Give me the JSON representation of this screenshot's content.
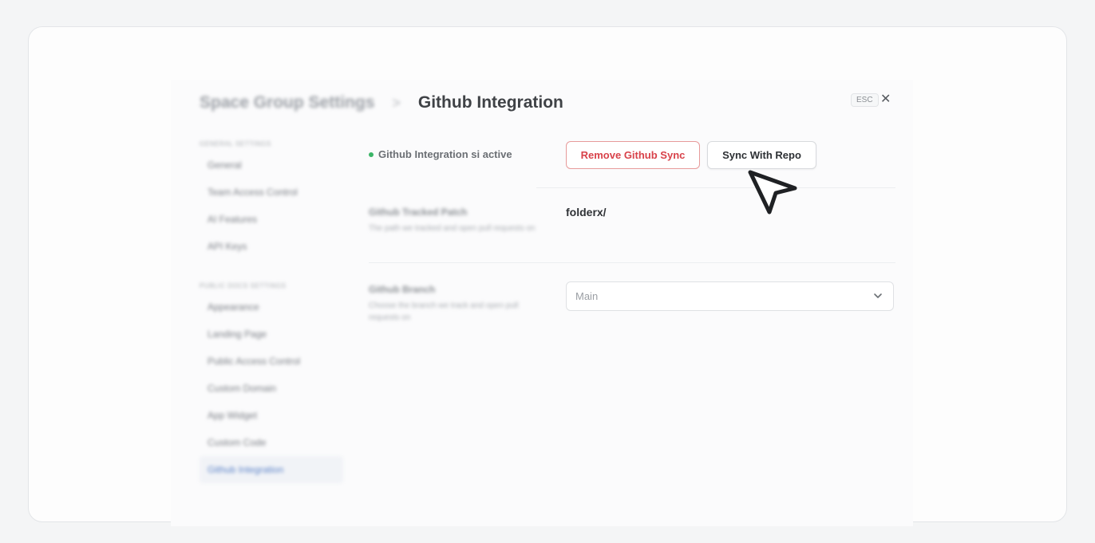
{
  "header": {
    "breadcrumb_parent": "Space Group Settings",
    "breadcrumb_separator": ">",
    "title": "Github Integration",
    "esc_label": "ESC",
    "close_icon": "close-icon"
  },
  "sidebar": {
    "sections": [
      {
        "heading": "GENERAL SETTINGS",
        "items": [
          {
            "label": "General",
            "active": false
          },
          {
            "label": "Team Access Control",
            "active": false
          },
          {
            "label": "AI Features",
            "active": false
          },
          {
            "label": "API Keys",
            "active": false
          }
        ]
      },
      {
        "heading": "PUBLIC DOCS SETTINGS",
        "items": [
          {
            "label": "Appearance",
            "active": false
          },
          {
            "label": "Landing Page",
            "active": false
          },
          {
            "label": "Public Access Control",
            "active": false
          },
          {
            "label": "Custom Domain",
            "active": false
          },
          {
            "label": "App Widget",
            "active": false
          },
          {
            "label": "Custom Code",
            "active": false
          },
          {
            "label": "Github Integration",
            "active": true
          }
        ]
      }
    ]
  },
  "main": {
    "status_text": "Github Integration si active",
    "status_color": "#3bb567",
    "remove_button_label": "Remove Github Sync",
    "sync_button_label": "Sync With Repo",
    "tracked_path": {
      "label": "Github Tracked Patch",
      "description": "The path we tracked and open pull requests on",
      "value": "folderx/"
    },
    "branch": {
      "label": "Github Branch",
      "description": "Choose the branch we track and open pull requests on",
      "selected": "Main"
    }
  },
  "colors": {
    "danger": "#d8424a",
    "accent": "#5b82c7"
  }
}
